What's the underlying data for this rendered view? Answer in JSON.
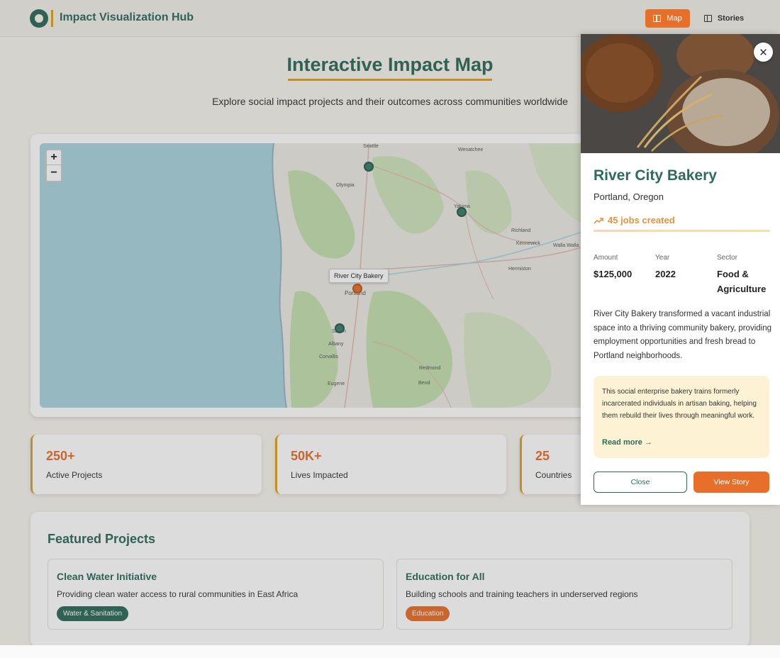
{
  "header": {
    "title": "Impact Visualization Hub",
    "nav": [
      {
        "label": "Map",
        "active": true,
        "icon": "map-icon"
      },
      {
        "label": "Stories",
        "active": false,
        "icon": "book-icon"
      }
    ]
  },
  "hero": {
    "title": "Interactive Impact Map",
    "subtitle": "Explore social impact projects and their outcomes across communities worldwide"
  },
  "map": {
    "zoom_in": "+",
    "zoom_out": "−",
    "tooltip": "River City Bakery",
    "cities": [
      "Seattle",
      "Wenatchee",
      "Olympia",
      "Yakima",
      "Richland",
      "Kennewick",
      "Walla Walla",
      "Hermiston",
      "Portland",
      "Salem",
      "Albany",
      "Corvallis",
      "Redmond",
      "Bend",
      "Eugene"
    ]
  },
  "stats": [
    {
      "value": "250+",
      "label": "Active Projects"
    },
    {
      "value": "50K+",
      "label": "Lives Impacted"
    },
    {
      "value": "25",
      "label": "Countries"
    }
  ],
  "featured": {
    "title": "Featured Projects",
    "projects": [
      {
        "title": "Clean Water Initiative",
        "description": "Providing clean water access to rural communities in East Africa",
        "tag": "Water & Sanitation",
        "tag_color": "#2e6b5a"
      },
      {
        "title": "Education for All",
        "description": "Building schools and training teachers in underserved regions",
        "tag": "Education",
        "tag_color": "#e86f2a"
      }
    ]
  },
  "panel": {
    "title": "River City Bakery",
    "location": "Portland, Oregon",
    "jobs": "45 jobs created",
    "meta": [
      {
        "label": "Amount",
        "value": "$125,000"
      },
      {
        "label": "Year",
        "value": "2022"
      },
      {
        "label": "Sector",
        "value": "Food & Agriculture"
      }
    ],
    "description": "River City Bakery transformed a vacant industrial space into a thriving community bakery, providing employment opportunities and fresh bread to Portland neighborhoods.",
    "quote": "This social enterprise bakery trains formerly incarcerated individuals in artisan baking, helping them rebuild their lives through meaningful work.",
    "read_more": "Read more →",
    "close_label": "Close",
    "story_label": "View Story"
  },
  "colors": {
    "primary": "#2e6b5a",
    "accent": "#e86f2a",
    "gold": "#e0a21b"
  }
}
